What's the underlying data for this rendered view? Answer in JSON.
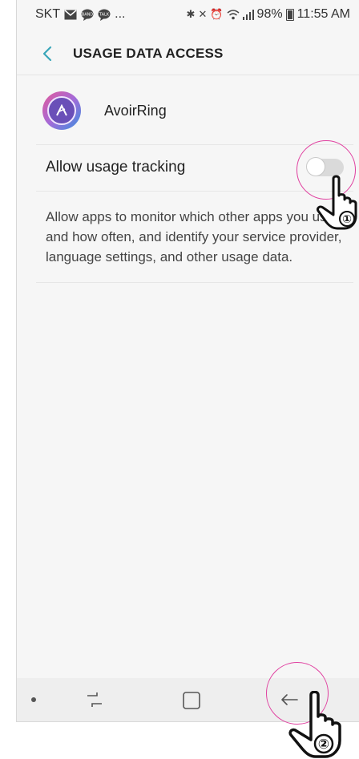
{
  "status_bar": {
    "carrier": "SKT",
    "notification_icons": [
      "mail-icon",
      "band-chat-icon",
      "talk-chat-icon"
    ],
    "more": "...",
    "system_icons": [
      "bluetooth-icon",
      "mute-icon",
      "alarm-icon",
      "wifi-icon",
      "signal-icon",
      "battery-icon"
    ],
    "battery": "98%",
    "time": "11:55 AM"
  },
  "app_bar": {
    "back_icon": "chevron-left-icon",
    "title": "USAGE DATA ACCESS"
  },
  "app": {
    "name": "AvoirRing",
    "icon": "avoirring-app-icon"
  },
  "setting": {
    "label": "Allow usage tracking",
    "enabled": false,
    "description": "Allow apps to monitor which other apps you use and how often, and identify your service provider, language settings, and other usage data."
  },
  "nav_bar": {
    "items": [
      "dot-icon",
      "recent-apps-icon",
      "home-icon",
      "back-arrow-icon"
    ]
  },
  "annotations": {
    "step1": "①",
    "step2": "②",
    "highlight_color": "#e040a0"
  },
  "colors": {
    "accent": "#3aa6b9",
    "background": "#f6f6f6",
    "navbar": "#eeeeee"
  }
}
